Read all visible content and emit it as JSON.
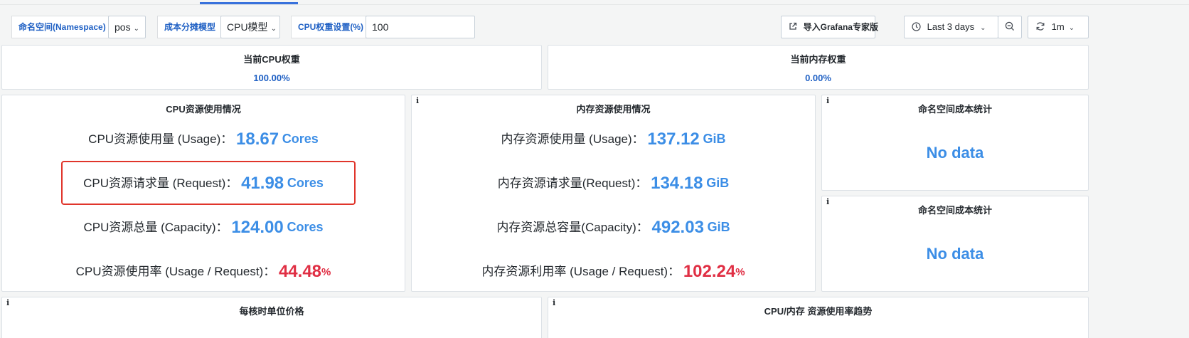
{
  "toolbar": {
    "namespace_label": "命名空间(Namespace)",
    "namespace_value": "pos",
    "cost_model_label": "成本分摊模型",
    "cost_model_value": "CPU模型",
    "cpu_weight_label": "CPU权重设置(%)",
    "cpu_weight_value": "100",
    "import_button": "导入Grafana专家版",
    "time_range": "Last 3 days",
    "refresh_interval": "1m"
  },
  "weights": {
    "cpu_title": "当前CPU权重",
    "cpu_value": "100.00%",
    "mem_title": "当前内存权重",
    "mem_value": "0.00%"
  },
  "cpu_panel": {
    "title": "CPU资源使用情况",
    "usage_label": "CPU资源使用量 (Usage)：",
    "usage_value": "18.67",
    "usage_unit": "Cores",
    "request_label": "CPU资源请求量 (Request)：",
    "request_value": "41.98",
    "request_unit": "Cores",
    "capacity_label": "CPU资源总量 (Capacity)：",
    "capacity_value": "124.00",
    "capacity_unit": "Cores",
    "rate_label": "CPU资源使用率 (Usage / Request)：",
    "rate_value": "44.48",
    "rate_unit": "%"
  },
  "mem_panel": {
    "info": "i",
    "title": "内存资源使用情况",
    "usage_label": "内存资源使用量 (Usage)：",
    "usage_value": "137.12",
    "usage_unit": "GiB",
    "request_label": "内存资源请求量(Request)：",
    "request_value": "134.18",
    "request_unit": "GiB",
    "capacity_label": "内存资源总容量(Capacity)：",
    "capacity_value": "492.03",
    "capacity_unit": "GiB",
    "rate_label": "内存资源利用率 (Usage / Request)：",
    "rate_value": "102.24",
    "rate_unit": "%"
  },
  "ns_cost_panels": [
    {
      "info": "i",
      "title": "命名空间成本统计",
      "value": "No data"
    },
    {
      "info": "i",
      "title": "命名空间成本统计",
      "value": "No data"
    }
  ],
  "bottom_panels": [
    {
      "info": "i",
      "title": "每核时单位价格"
    },
    {
      "info": "i",
      "title": "CPU/内存 资源使用率趋势"
    }
  ],
  "colors": {
    "accent_blue": "#3c8ee6",
    "label_blue": "#1f60c4",
    "alert_red": "#e02f44",
    "highlight_red": "#e0352b"
  },
  "icons": [
    "chevron-down-icon",
    "external-link-icon",
    "clock-icon",
    "zoom-out-icon",
    "refresh-icon"
  ]
}
